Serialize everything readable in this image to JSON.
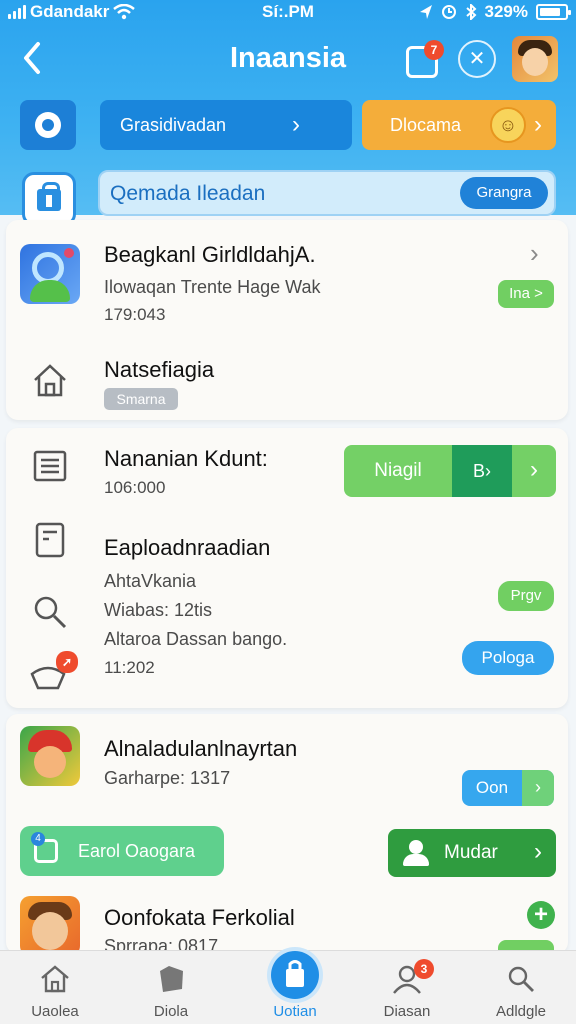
{
  "status_bar": {
    "carrier": "Gdandakr",
    "time": "Sí:.PM",
    "battery": "329%"
  },
  "header": {
    "title": "Inaansia",
    "clip_badge": "7",
    "back_icon": "chevron-left-icon",
    "close_icon": "x-icon"
  },
  "quick_row": {
    "blue_label": "Grasidivadan",
    "orange_label": "Dlocama"
  },
  "search": {
    "value": "Qemada Ileadan",
    "button_label": "Grangra"
  },
  "list": {
    "item1": {
      "title": "Beagkanl GirldldahjA.",
      "sub1": "Ilowaqan Trente Hage Wak",
      "sub2": "179:043",
      "chip": "Ina >"
    },
    "item2": {
      "title": "Natsefiagia",
      "chip": "Smarna"
    },
    "item3": {
      "title": "Nananian Kdunt:",
      "sub": "106:000",
      "btn_label": "Niagil",
      "btn_mid": "B›",
      "btn_chev": "›"
    },
    "item4": {
      "title": "Eaploadnraadian",
      "line1": "AhtaVkania",
      "line2": "Wiabas: 12tis",
      "line3": "Altaroa Dassan bango.",
      "line4": "11:202",
      "chip_green": "Prgv",
      "chip_blue": "Pologa"
    },
    "item5": {
      "title": "Alnaladulanlnayrtan",
      "sub": "Garharpe: 1317",
      "btn_label": "Oon",
      "btn_chev": "›"
    },
    "action_row": {
      "green_label": "Earol Oaogara",
      "green_badge": "4",
      "dark_label": "Mudar",
      "dark_chev": "›"
    },
    "item6": {
      "title": "Oonfokata Ferkolial",
      "sub": "Sprrapa: 0817"
    }
  },
  "bottom_nav": {
    "items": [
      {
        "label": "Uaolea",
        "icon": "home-icon"
      },
      {
        "label": "Diola",
        "icon": "tag-icon"
      },
      {
        "label": "Uotian",
        "icon": "bag-icon",
        "active": true
      },
      {
        "label": "Diasan",
        "icon": "profile-icon",
        "badge": "3"
      },
      {
        "label": "Adldgle",
        "icon": "search-icon"
      }
    ]
  },
  "colors": {
    "header_blue": "#2aa3ee",
    "accent_orange": "#f4ad3a",
    "accent_green": "#71cf62",
    "dark_green": "#2f9c3f"
  }
}
